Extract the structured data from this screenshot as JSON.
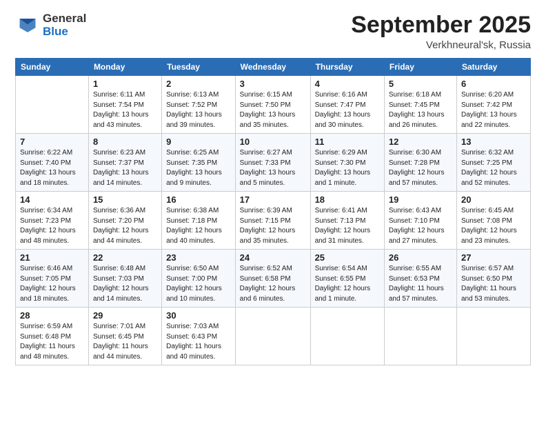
{
  "header": {
    "logo_general": "General",
    "logo_blue": "Blue",
    "month": "September 2025",
    "location": "Verkhneural'sk, Russia"
  },
  "days_of_week": [
    "Sunday",
    "Monday",
    "Tuesday",
    "Wednesday",
    "Thursday",
    "Friday",
    "Saturday"
  ],
  "weeks": [
    [
      {
        "day": "",
        "sunrise": "",
        "sunset": "",
        "daylight": ""
      },
      {
        "day": "1",
        "sunrise": "Sunrise: 6:11 AM",
        "sunset": "Sunset: 7:54 PM",
        "daylight": "Daylight: 13 hours and 43 minutes."
      },
      {
        "day": "2",
        "sunrise": "Sunrise: 6:13 AM",
        "sunset": "Sunset: 7:52 PM",
        "daylight": "Daylight: 13 hours and 39 minutes."
      },
      {
        "day": "3",
        "sunrise": "Sunrise: 6:15 AM",
        "sunset": "Sunset: 7:50 PM",
        "daylight": "Daylight: 13 hours and 35 minutes."
      },
      {
        "day": "4",
        "sunrise": "Sunrise: 6:16 AM",
        "sunset": "Sunset: 7:47 PM",
        "daylight": "Daylight: 13 hours and 30 minutes."
      },
      {
        "day": "5",
        "sunrise": "Sunrise: 6:18 AM",
        "sunset": "Sunset: 7:45 PM",
        "daylight": "Daylight: 13 hours and 26 minutes."
      },
      {
        "day": "6",
        "sunrise": "Sunrise: 6:20 AM",
        "sunset": "Sunset: 7:42 PM",
        "daylight": "Daylight: 13 hours and 22 minutes."
      }
    ],
    [
      {
        "day": "7",
        "sunrise": "Sunrise: 6:22 AM",
        "sunset": "Sunset: 7:40 PM",
        "daylight": "Daylight: 13 hours and 18 minutes."
      },
      {
        "day": "8",
        "sunrise": "Sunrise: 6:23 AM",
        "sunset": "Sunset: 7:37 PM",
        "daylight": "Daylight: 13 hours and 14 minutes."
      },
      {
        "day": "9",
        "sunrise": "Sunrise: 6:25 AM",
        "sunset": "Sunset: 7:35 PM",
        "daylight": "Daylight: 13 hours and 9 minutes."
      },
      {
        "day": "10",
        "sunrise": "Sunrise: 6:27 AM",
        "sunset": "Sunset: 7:33 PM",
        "daylight": "Daylight: 13 hours and 5 minutes."
      },
      {
        "day": "11",
        "sunrise": "Sunrise: 6:29 AM",
        "sunset": "Sunset: 7:30 PM",
        "daylight": "Daylight: 13 hours and 1 minute."
      },
      {
        "day": "12",
        "sunrise": "Sunrise: 6:30 AM",
        "sunset": "Sunset: 7:28 PM",
        "daylight": "Daylight: 12 hours and 57 minutes."
      },
      {
        "day": "13",
        "sunrise": "Sunrise: 6:32 AM",
        "sunset": "Sunset: 7:25 PM",
        "daylight": "Daylight: 12 hours and 52 minutes."
      }
    ],
    [
      {
        "day": "14",
        "sunrise": "Sunrise: 6:34 AM",
        "sunset": "Sunset: 7:23 PM",
        "daylight": "Daylight: 12 hours and 48 minutes."
      },
      {
        "day": "15",
        "sunrise": "Sunrise: 6:36 AM",
        "sunset": "Sunset: 7:20 PM",
        "daylight": "Daylight: 12 hours and 44 minutes."
      },
      {
        "day": "16",
        "sunrise": "Sunrise: 6:38 AM",
        "sunset": "Sunset: 7:18 PM",
        "daylight": "Daylight: 12 hours and 40 minutes."
      },
      {
        "day": "17",
        "sunrise": "Sunrise: 6:39 AM",
        "sunset": "Sunset: 7:15 PM",
        "daylight": "Daylight: 12 hours and 35 minutes."
      },
      {
        "day": "18",
        "sunrise": "Sunrise: 6:41 AM",
        "sunset": "Sunset: 7:13 PM",
        "daylight": "Daylight: 12 hours and 31 minutes."
      },
      {
        "day": "19",
        "sunrise": "Sunrise: 6:43 AM",
        "sunset": "Sunset: 7:10 PM",
        "daylight": "Daylight: 12 hours and 27 minutes."
      },
      {
        "day": "20",
        "sunrise": "Sunrise: 6:45 AM",
        "sunset": "Sunset: 7:08 PM",
        "daylight": "Daylight: 12 hours and 23 minutes."
      }
    ],
    [
      {
        "day": "21",
        "sunrise": "Sunrise: 6:46 AM",
        "sunset": "Sunset: 7:05 PM",
        "daylight": "Daylight: 12 hours and 18 minutes."
      },
      {
        "day": "22",
        "sunrise": "Sunrise: 6:48 AM",
        "sunset": "Sunset: 7:03 PM",
        "daylight": "Daylight: 12 hours and 14 minutes."
      },
      {
        "day": "23",
        "sunrise": "Sunrise: 6:50 AM",
        "sunset": "Sunset: 7:00 PM",
        "daylight": "Daylight: 12 hours and 10 minutes."
      },
      {
        "day": "24",
        "sunrise": "Sunrise: 6:52 AM",
        "sunset": "Sunset: 6:58 PM",
        "daylight": "Daylight: 12 hours and 6 minutes."
      },
      {
        "day": "25",
        "sunrise": "Sunrise: 6:54 AM",
        "sunset": "Sunset: 6:55 PM",
        "daylight": "Daylight: 12 hours and 1 minute."
      },
      {
        "day": "26",
        "sunrise": "Sunrise: 6:55 AM",
        "sunset": "Sunset: 6:53 PM",
        "daylight": "Daylight: 11 hours and 57 minutes."
      },
      {
        "day": "27",
        "sunrise": "Sunrise: 6:57 AM",
        "sunset": "Sunset: 6:50 PM",
        "daylight": "Daylight: 11 hours and 53 minutes."
      }
    ],
    [
      {
        "day": "28",
        "sunrise": "Sunrise: 6:59 AM",
        "sunset": "Sunset: 6:48 PM",
        "daylight": "Daylight: 11 hours and 48 minutes."
      },
      {
        "day": "29",
        "sunrise": "Sunrise: 7:01 AM",
        "sunset": "Sunset: 6:45 PM",
        "daylight": "Daylight: 11 hours and 44 minutes."
      },
      {
        "day": "30",
        "sunrise": "Sunrise: 7:03 AM",
        "sunset": "Sunset: 6:43 PM",
        "daylight": "Daylight: 11 hours and 40 minutes."
      },
      {
        "day": "",
        "sunrise": "",
        "sunset": "",
        "daylight": ""
      },
      {
        "day": "",
        "sunrise": "",
        "sunset": "",
        "daylight": ""
      },
      {
        "day": "",
        "sunrise": "",
        "sunset": "",
        "daylight": ""
      },
      {
        "day": "",
        "sunrise": "",
        "sunset": "",
        "daylight": ""
      }
    ]
  ]
}
